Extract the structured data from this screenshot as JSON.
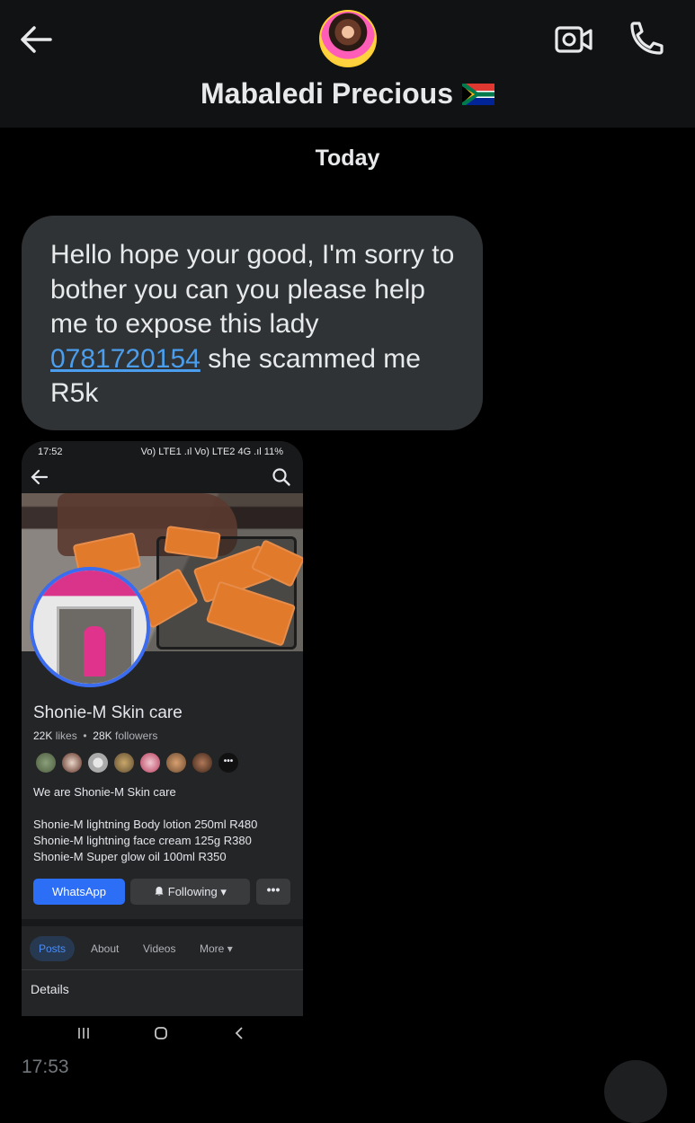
{
  "header": {
    "contact_name": "Mabaledi Precious",
    "flag_icon": "south-africa-flag-icon",
    "background": "#101214"
  },
  "conversation": {
    "date_separator": "Today",
    "message": {
      "text_before": "Hello hope your good, I'm sorry to bother you can you please help me to expose this lady",
      "phone_link": "0781720154",
      "text_after": "she scammed me R5k",
      "bubble_color": "#2f3336",
      "link_color": "#4a9eed"
    },
    "attachment": {
      "status_bar": {
        "time": "17:52",
        "right": "Vo) LTE1 .ıl Vo) LTE2 4G .ıl 11%"
      },
      "page": {
        "name": "Shonie-M Skin care",
        "likes_count": "22K",
        "likes_label": "likes",
        "followers_count": "28K",
        "followers_label": "followers",
        "intro": "We are Shonie-M Skin care",
        "products": [
          "Shonie-M lightning Body lotion 250ml R480",
          "Shonie-M lightning face cream 125g R380",
          "Shonie-M Super glow oil 100ml R350"
        ],
        "whatsapp_button": "WhatsApp",
        "following_button": "Following",
        "more_button": "•••",
        "friend_more": "•••",
        "tabs": [
          "Posts",
          "About",
          "Videos",
          "More"
        ],
        "active_tab": "Posts",
        "details_heading": "Details",
        "accent": "#2d6ef6"
      }
    },
    "timestamp": "17:53"
  }
}
